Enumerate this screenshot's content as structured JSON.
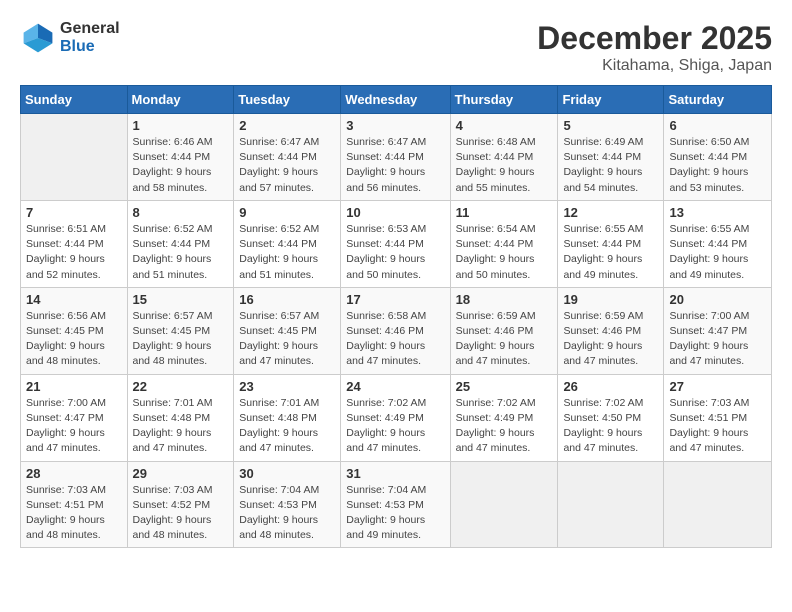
{
  "header": {
    "logo": {
      "general": "General",
      "blue": "Blue"
    },
    "title": "December 2025",
    "subtitle": "Kitahama, Shiga, Japan"
  },
  "calendar": {
    "days_of_week": [
      "Sunday",
      "Monday",
      "Tuesday",
      "Wednesday",
      "Thursday",
      "Friday",
      "Saturday"
    ],
    "weeks": [
      [
        {
          "day": "",
          "info": ""
        },
        {
          "day": "1",
          "info": "Sunrise: 6:46 AM\nSunset: 4:44 PM\nDaylight: 9 hours\nand 58 minutes."
        },
        {
          "day": "2",
          "info": "Sunrise: 6:47 AM\nSunset: 4:44 PM\nDaylight: 9 hours\nand 57 minutes."
        },
        {
          "day": "3",
          "info": "Sunrise: 6:47 AM\nSunset: 4:44 PM\nDaylight: 9 hours\nand 56 minutes."
        },
        {
          "day": "4",
          "info": "Sunrise: 6:48 AM\nSunset: 4:44 PM\nDaylight: 9 hours\nand 55 minutes."
        },
        {
          "day": "5",
          "info": "Sunrise: 6:49 AM\nSunset: 4:44 PM\nDaylight: 9 hours\nand 54 minutes."
        },
        {
          "day": "6",
          "info": "Sunrise: 6:50 AM\nSunset: 4:44 PM\nDaylight: 9 hours\nand 53 minutes."
        }
      ],
      [
        {
          "day": "7",
          "info": "Sunrise: 6:51 AM\nSunset: 4:44 PM\nDaylight: 9 hours\nand 52 minutes."
        },
        {
          "day": "8",
          "info": "Sunrise: 6:52 AM\nSunset: 4:44 PM\nDaylight: 9 hours\nand 51 minutes."
        },
        {
          "day": "9",
          "info": "Sunrise: 6:52 AM\nSunset: 4:44 PM\nDaylight: 9 hours\nand 51 minutes."
        },
        {
          "day": "10",
          "info": "Sunrise: 6:53 AM\nSunset: 4:44 PM\nDaylight: 9 hours\nand 50 minutes."
        },
        {
          "day": "11",
          "info": "Sunrise: 6:54 AM\nSunset: 4:44 PM\nDaylight: 9 hours\nand 50 minutes."
        },
        {
          "day": "12",
          "info": "Sunrise: 6:55 AM\nSunset: 4:44 PM\nDaylight: 9 hours\nand 49 minutes."
        },
        {
          "day": "13",
          "info": "Sunrise: 6:55 AM\nSunset: 4:44 PM\nDaylight: 9 hours\nand 49 minutes."
        }
      ],
      [
        {
          "day": "14",
          "info": "Sunrise: 6:56 AM\nSunset: 4:45 PM\nDaylight: 9 hours\nand 48 minutes."
        },
        {
          "day": "15",
          "info": "Sunrise: 6:57 AM\nSunset: 4:45 PM\nDaylight: 9 hours\nand 48 minutes."
        },
        {
          "day": "16",
          "info": "Sunrise: 6:57 AM\nSunset: 4:45 PM\nDaylight: 9 hours\nand 47 minutes."
        },
        {
          "day": "17",
          "info": "Sunrise: 6:58 AM\nSunset: 4:46 PM\nDaylight: 9 hours\nand 47 minutes."
        },
        {
          "day": "18",
          "info": "Sunrise: 6:59 AM\nSunset: 4:46 PM\nDaylight: 9 hours\nand 47 minutes."
        },
        {
          "day": "19",
          "info": "Sunrise: 6:59 AM\nSunset: 4:46 PM\nDaylight: 9 hours\nand 47 minutes."
        },
        {
          "day": "20",
          "info": "Sunrise: 7:00 AM\nSunset: 4:47 PM\nDaylight: 9 hours\nand 47 minutes."
        }
      ],
      [
        {
          "day": "21",
          "info": "Sunrise: 7:00 AM\nSunset: 4:47 PM\nDaylight: 9 hours\nand 47 minutes."
        },
        {
          "day": "22",
          "info": "Sunrise: 7:01 AM\nSunset: 4:48 PM\nDaylight: 9 hours\nand 47 minutes."
        },
        {
          "day": "23",
          "info": "Sunrise: 7:01 AM\nSunset: 4:48 PM\nDaylight: 9 hours\nand 47 minutes."
        },
        {
          "day": "24",
          "info": "Sunrise: 7:02 AM\nSunset: 4:49 PM\nDaylight: 9 hours\nand 47 minutes."
        },
        {
          "day": "25",
          "info": "Sunrise: 7:02 AM\nSunset: 4:49 PM\nDaylight: 9 hours\nand 47 minutes."
        },
        {
          "day": "26",
          "info": "Sunrise: 7:02 AM\nSunset: 4:50 PM\nDaylight: 9 hours\nand 47 minutes."
        },
        {
          "day": "27",
          "info": "Sunrise: 7:03 AM\nSunset: 4:51 PM\nDaylight: 9 hours\nand 47 minutes."
        }
      ],
      [
        {
          "day": "28",
          "info": "Sunrise: 7:03 AM\nSunset: 4:51 PM\nDaylight: 9 hours\nand 48 minutes."
        },
        {
          "day": "29",
          "info": "Sunrise: 7:03 AM\nSunset: 4:52 PM\nDaylight: 9 hours\nand 48 minutes."
        },
        {
          "day": "30",
          "info": "Sunrise: 7:04 AM\nSunset: 4:53 PM\nDaylight: 9 hours\nand 48 minutes."
        },
        {
          "day": "31",
          "info": "Sunrise: 7:04 AM\nSunset: 4:53 PM\nDaylight: 9 hours\nand 49 minutes."
        },
        {
          "day": "",
          "info": ""
        },
        {
          "day": "",
          "info": ""
        },
        {
          "day": "",
          "info": ""
        }
      ]
    ]
  }
}
